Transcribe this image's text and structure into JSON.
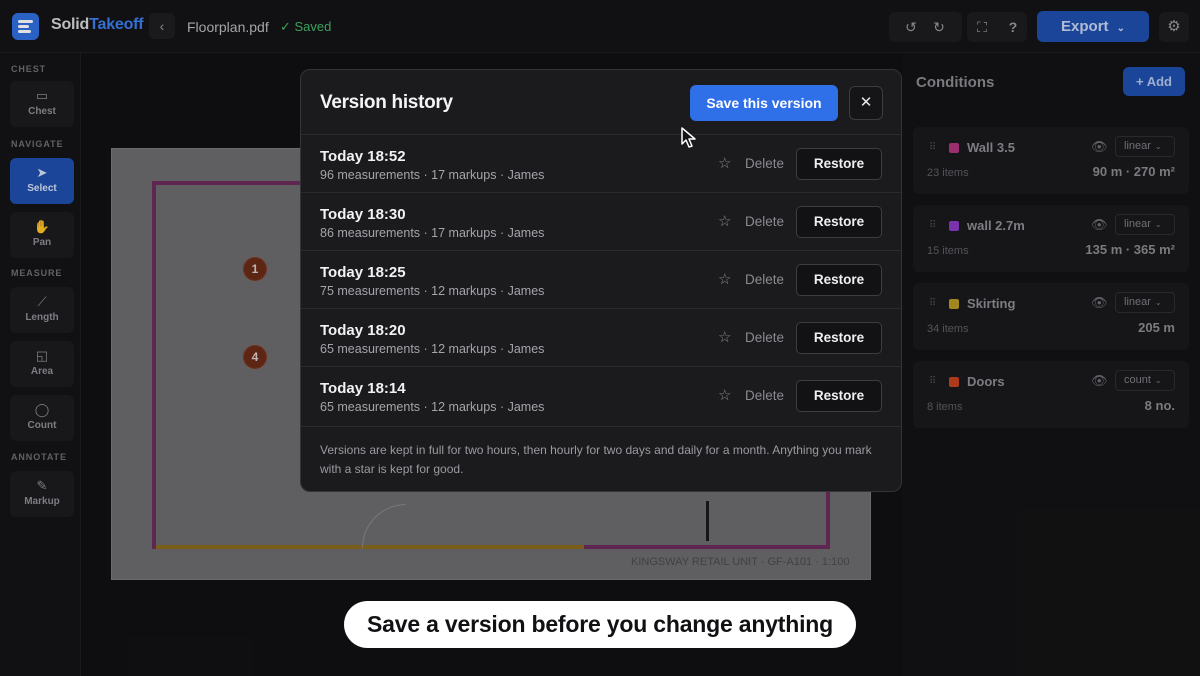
{
  "app": {
    "brand_part1": "Solid",
    "brand_part2": "Takeoff",
    "file_name": "Floorplan.pdf",
    "save_status": "Saved",
    "export_label": "Export",
    "brand_color": "#2f6fe0"
  },
  "toolbar_icons": [
    "undo-icon",
    "redo-icon",
    "fullscreen-icon",
    "help-icon",
    "settings-icon"
  ],
  "help_glyph": "?",
  "leftbar": {
    "sections": {
      "chest": "CHEST",
      "navigate": "NAVIGATE",
      "measure": "MEASURE",
      "annotate": "ANNOTATE"
    },
    "tools": [
      {
        "label": "Chest",
        "icon": "box-icon",
        "active": false
      },
      {
        "label": "Select",
        "icon": "pointer-icon",
        "active": true
      },
      {
        "label": "Pan",
        "icon": "hand-icon",
        "active": false
      },
      {
        "label": "Length",
        "icon": "ruler-icon",
        "active": false
      },
      {
        "label": "Area",
        "icon": "area-icon",
        "active": false
      },
      {
        "label": "Count",
        "icon": "pin-icon",
        "active": false
      },
      {
        "label": "Markup",
        "icon": "pencil-icon",
        "active": false
      }
    ]
  },
  "canvas": {
    "markers": [
      "1",
      "4"
    ],
    "title_block": "KINGSWAY RETAIL UNIT · GF-A101 · 1:100"
  },
  "conditions": {
    "title": "Conditions",
    "add_label": "+ Add",
    "items": [
      {
        "name": "Wall 3.5",
        "color": "#b0357e",
        "type": "linear",
        "count": "23 items",
        "total": "90 m · 270 m²"
      },
      {
        "name": "wall 2.7m",
        "color": "#8a3bc4",
        "type": "linear",
        "count": "15 items",
        "total": "135 m · 365 m²"
      },
      {
        "name": "Skirting",
        "color": "#b89a22",
        "type": "linear",
        "count": "34 items",
        "total": "205 m"
      },
      {
        "name": "Doors",
        "color": "#c4421f",
        "type": "count",
        "count": "8 items",
        "total": "8 no."
      }
    ]
  },
  "modal": {
    "title": "Version history",
    "save_label": "Save this version",
    "close_glyph": "✕",
    "delete_label": "Delete",
    "restore_label": "Restore",
    "versions": [
      {
        "time": "Today 18:52",
        "details": "96 measurements · 17 markups · James"
      },
      {
        "time": "Today 18:30",
        "details": "86 measurements · 17 markups · James"
      },
      {
        "time": "Today 18:25",
        "details": "75 measurements · 12 markups · James"
      },
      {
        "time": "Today 18:20",
        "details": "65 measurements · 12 markups · James"
      },
      {
        "time": "Today 18:14",
        "details": "65 measurements · 12 markups · James"
      }
    ],
    "footnote": "Versions are kept in full for two hours, then hourly for two days and daily for a month. Anything you mark with a star is kept for good."
  },
  "caption": "Save a version before you change anything"
}
